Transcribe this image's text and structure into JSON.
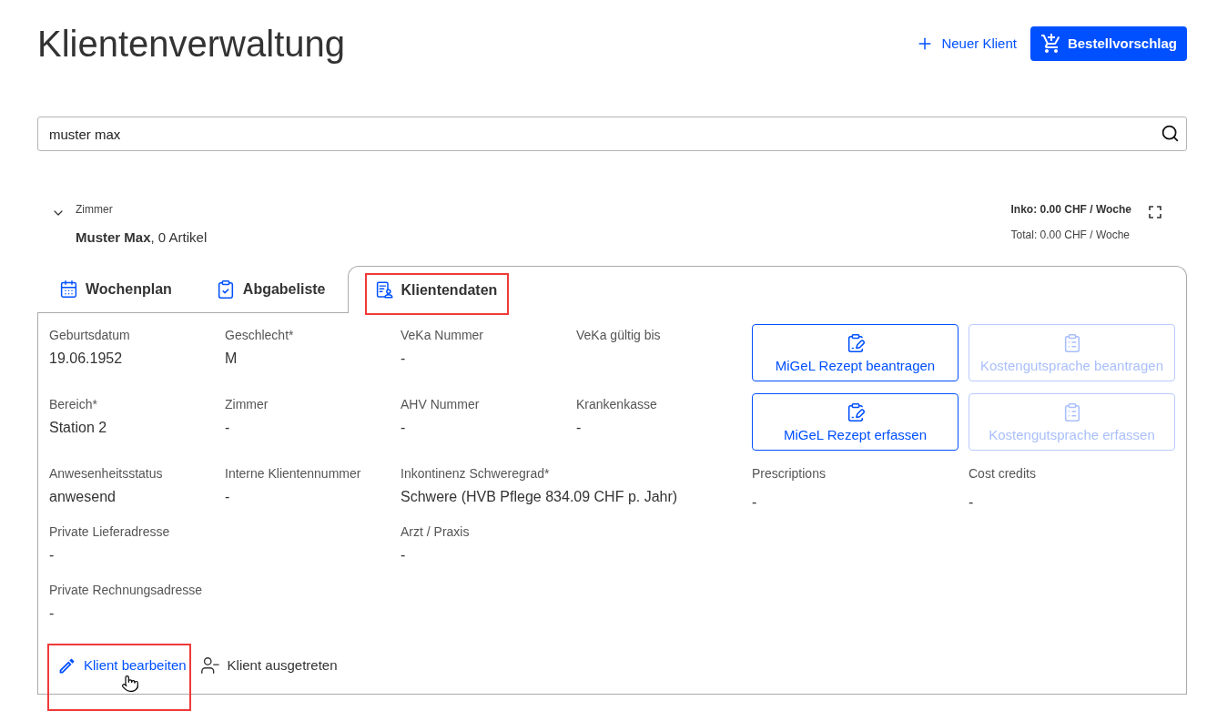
{
  "header": {
    "title": "Klientenverwaltung",
    "actions": [
      {
        "label": "Neuer Klient",
        "kind": "link"
      },
      {
        "label": "Bestellvorschlag",
        "kind": "primary"
      }
    ]
  },
  "search": {
    "value": "muster max"
  },
  "client": {
    "expanded": true,
    "room_label": "Zimmer",
    "name_line": "**Muster Max**, 0 Artikel",
    "inko": "Inko: 0.00 CHF / Woche",
    "total": "Total: 0.00 CHF / Woche"
  },
  "tabs": [
    {
      "label": "Wochenplan",
      "kind": "calendar",
      "selected": false,
      "highlighted": false
    },
    {
      "label": "Abgabeliste",
      "kind": "checklist",
      "selected": false,
      "highlighted": false
    },
    {
      "label": "Klientendaten",
      "kind": "client",
      "selected": true,
      "highlighted": true
    }
  ],
  "client_data": {
    "rows": [
      [
        {
          "label": "Geburtsdatum",
          "value": "19.06.1952"
        },
        {
          "label": "Geschlecht*",
          "value": "M"
        },
        {
          "label": "VeKa Nummer",
          "value": "-"
        },
        {
          "label": "VeKa gültig bis"
        }
      ],
      [
        {
          "label": "Bereich*",
          "value": "Station 2"
        },
        {
          "label": "Zimmer",
          "value": "-"
        },
        {
          "label": "AHV Nummer",
          "value": "-"
        },
        {
          "label": "Krankenkasse",
          "value": "-"
        }
      ],
      [
        {
          "label": "Anwesenheitsstatus",
          "value": "anwesend"
        },
        {
          "label": "Interne Klientennummer",
          "value": "-"
        },
        {
          "label": "Inkontinenz Schweregrad*",
          "value": "Schwere (HVB Pflege 834.09 CHF p. Jahr)"
        },
        ""
      ],
      [
        {
          "label": "Private Lieferadresse",
          "value": "-"
        },
        "",
        {
          "label": "Arzt / Praxis",
          "value": "-"
        },
        ""
      ],
      [
        {
          "label": "Private Rechnungsadresse",
          "value": "-"
        },
        "",
        "",
        ""
      ]
    ],
    "document_buttons": [
      {
        "label": "MiGeL Rezept beantragen",
        "kind": "prescription",
        "disabled": false
      },
      {
        "label": "Kostengutsprache beantragen",
        "kind": "cost_credit",
        "disabled": true
      },
      {
        "label": "MiGeL Rezept erfassen",
        "kind": "prescription",
        "disabled": false
      },
      {
        "label": "Kostengutsprache erfassen",
        "kind": "cost_credit",
        "disabled": true
      }
    ],
    "documents": [
      {
        "label": "Prescriptions",
        "value": "-"
      },
      {
        "label": "Cost credits",
        "value": "-"
      }
    ]
  },
  "actions": [
    {
      "label": "Klient bearbeiten",
      "kind": "edit",
      "highlighted": true,
      "hovered": true
    },
    {
      "label": "Klient ausgetreten",
      "kind": "discharge",
      "highlighted": false,
      "hovered": false
    }
  ]
}
